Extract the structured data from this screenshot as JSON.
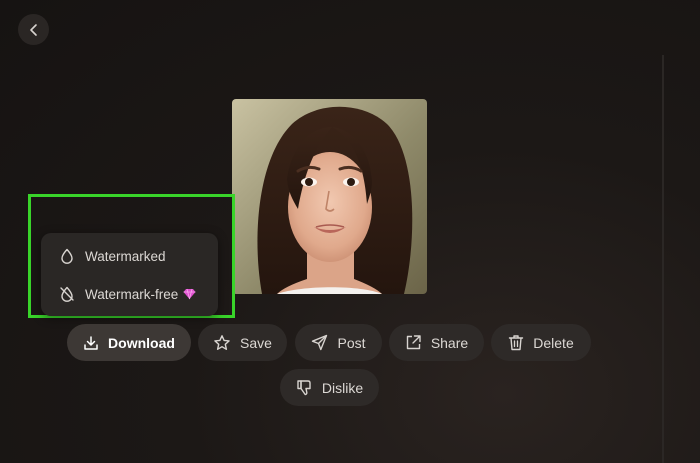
{
  "download_menu": {
    "items": [
      {
        "label": "Watermarked",
        "icon": "droplet-icon"
      },
      {
        "label": "Watermark-free",
        "icon": "droplet-off-icon",
        "badge_icon": "gem-icon"
      }
    ]
  },
  "actions": {
    "download": {
      "label": "Download",
      "icon": "download-icon"
    },
    "save": {
      "label": "Save",
      "icon": "star-icon"
    },
    "post": {
      "label": "Post",
      "icon": "send-icon"
    },
    "share": {
      "label": "Share",
      "icon": "share-icon"
    },
    "delete": {
      "label": "Delete",
      "icon": "trash-icon"
    },
    "dislike": {
      "label": "Dislike",
      "icon": "thumbs-down-icon"
    }
  },
  "colors": {
    "highlight": "#39d42a",
    "gem": "#e04fcf"
  }
}
